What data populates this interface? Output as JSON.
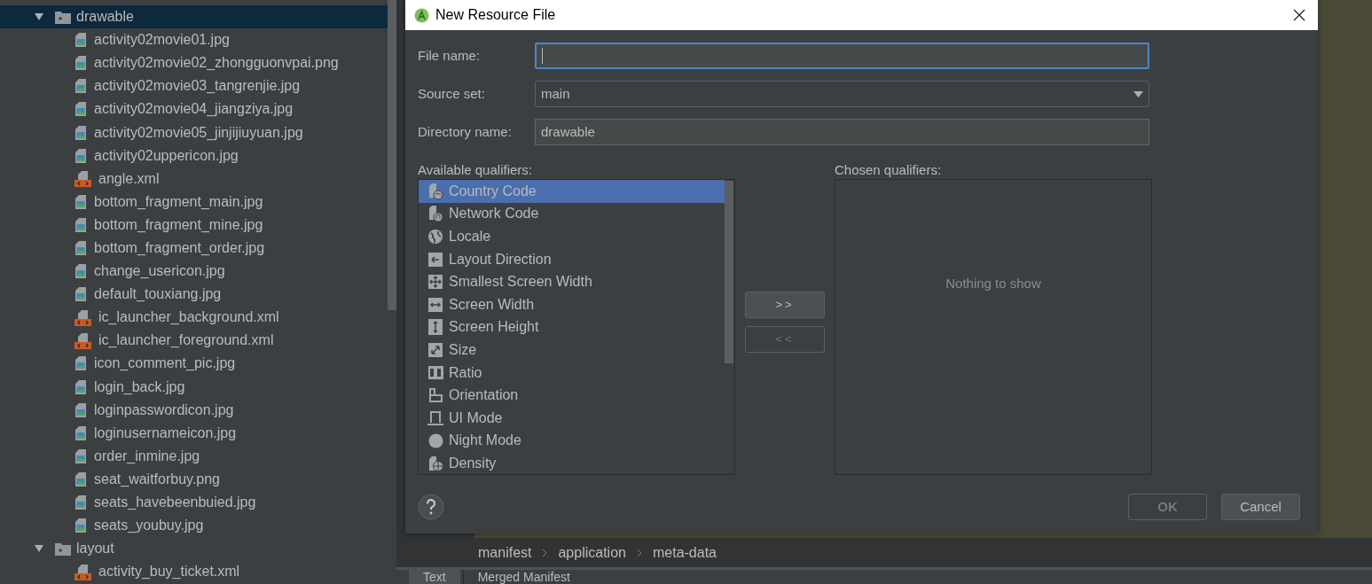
{
  "project_tree": {
    "items": [
      {
        "kind": "folder",
        "name": "drawable",
        "expanded": true,
        "selected": true,
        "children": [
          {
            "kind": "image",
            "name": "activity02movie01.jpg",
            "selected": false
          },
          {
            "kind": "image",
            "name": "activity02movie02_zhongguonvpai.png",
            "selected": false
          },
          {
            "kind": "image",
            "name": "activity02movie03_tangrenjie.jpg",
            "selected": false
          },
          {
            "kind": "image",
            "name": "activity02movie04_jiangziya.jpg",
            "selected": false
          },
          {
            "kind": "image",
            "name": "activity02movie05_jinjijiuyuan.jpg",
            "selected": false
          },
          {
            "kind": "image",
            "name": "activity02uppericon.jpg",
            "selected": false
          },
          {
            "kind": "xml",
            "name": "angle.xml",
            "selected": false
          },
          {
            "kind": "image",
            "name": "bottom_fragment_main.jpg",
            "selected": false
          },
          {
            "kind": "image",
            "name": "bottom_fragment_mine.jpg",
            "selected": false
          },
          {
            "kind": "image",
            "name": "bottom_fragment_order.jpg",
            "selected": false
          },
          {
            "kind": "image",
            "name": "change_usericon.jpg",
            "selected": false
          },
          {
            "kind": "image",
            "name": "default_touxiang.jpg",
            "selected": false
          },
          {
            "kind": "xml",
            "name": "ic_launcher_background.xml",
            "selected": false
          },
          {
            "kind": "xml",
            "name": "ic_launcher_foreground.xml",
            "selected": false
          },
          {
            "kind": "image",
            "name": "icon_comment_pic.jpg",
            "selected": false
          },
          {
            "kind": "image",
            "name": "login_back.jpg",
            "selected": false
          },
          {
            "kind": "image",
            "name": "loginpasswordicon.jpg",
            "selected": false
          },
          {
            "kind": "image",
            "name": "loginusernameicon.jpg",
            "selected": false
          },
          {
            "kind": "image",
            "name": "order_inmine.jpg",
            "selected": false
          },
          {
            "kind": "image",
            "name": "seat_waitforbuy.png",
            "selected": false
          },
          {
            "kind": "image",
            "name": "seats_havebeenbuied.jpg",
            "selected": false
          },
          {
            "kind": "image",
            "name": "seats_youbuy.jpg",
            "selected": false
          }
        ]
      },
      {
        "kind": "folder",
        "name": "layout",
        "expanded": true,
        "selected": false,
        "children": [
          {
            "kind": "xml",
            "name": "activity_buy_ticket.xml",
            "selected": false
          }
        ]
      }
    ]
  },
  "dialog": {
    "title": "New Resource File",
    "fields": [
      {
        "kind": "text",
        "label": "File name:",
        "focused": true
      },
      {
        "kind": "dropdown",
        "label": "Source set:",
        "value": "main"
      },
      {
        "kind": "text",
        "label": "Directory name:",
        "value": "drawable"
      }
    ],
    "available_qualifiers": {
      "label": "Available qualifiers:",
      "items": [
        {
          "name": "Country Code",
          "selected": true
        },
        {
          "name": "Network Code",
          "selected": false
        },
        {
          "name": "Locale",
          "selected": false
        },
        {
          "name": "Layout Direction",
          "selected": false
        },
        {
          "name": "Smallest Screen Width",
          "selected": false
        },
        {
          "name": "Screen Width",
          "selected": false
        },
        {
          "name": "Screen Height",
          "selected": false
        },
        {
          "name": "Size",
          "selected": false
        },
        {
          "name": "Ratio",
          "selected": false
        },
        {
          "name": "Orientation",
          "selected": false
        },
        {
          "name": "UI Mode",
          "selected": false
        },
        {
          "name": "Night Mode",
          "selected": false
        },
        {
          "name": "Density",
          "selected": false
        }
      ]
    },
    "move_buttons": [
      {
        "label": ">>",
        "disabled": false
      },
      {
        "label": "<<",
        "disabled": true
      }
    ],
    "chosen_qualifiers": {
      "label": "Chosen qualifiers:",
      "empty_text": "Nothing to show"
    },
    "buttons": [
      {
        "label": "OK",
        "disabled": true
      },
      {
        "label": "Cancel",
        "disabled": false
      }
    ]
  },
  "breadcrumbs": [
    "manifest",
    "application",
    "meta-data"
  ],
  "editor_tabs": [
    {
      "label": "Text",
      "selected": true
    },
    {
      "label": "Merged Manifest",
      "selected": false
    }
  ]
}
